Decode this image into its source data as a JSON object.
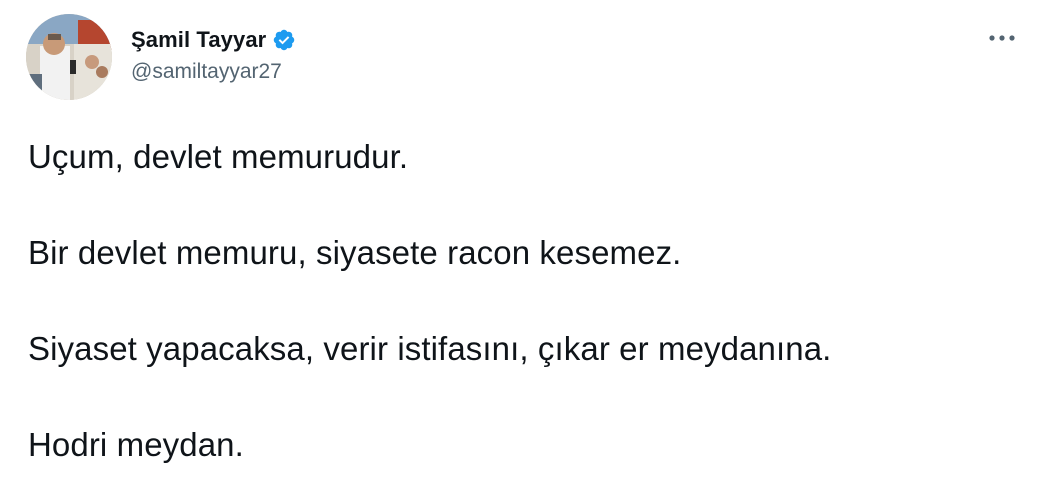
{
  "author": {
    "display_name": "Şamil Tayyar",
    "handle": "@samiltayyar27",
    "verified": true,
    "verified_color": "#1d9bf0"
  },
  "icons": {
    "verified": "verified-badge-icon",
    "more": "more-options-icon"
  },
  "tweet": {
    "paragraphs": [
      "Uçum, devlet memurudur.",
      "Bir devlet memuru, siyasete racon kesemez.",
      "Siyaset yapacaksa, verir istifasını, çıkar er meydanına.",
      "Hodri meydan."
    ]
  },
  "colors": {
    "text": "#0f1419",
    "secondary": "#536471",
    "background": "#ffffff"
  }
}
